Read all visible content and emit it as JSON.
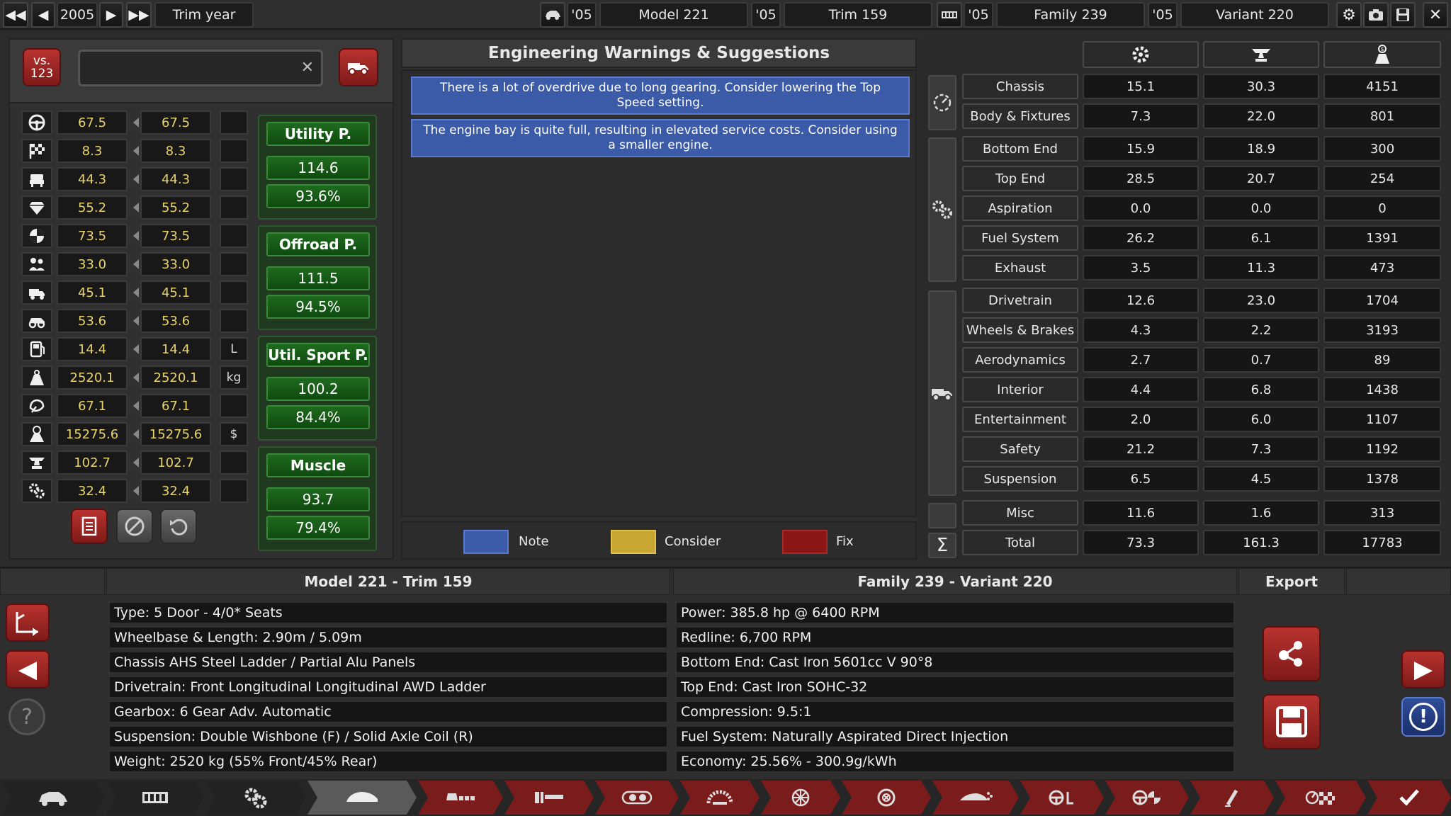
{
  "topbar": {
    "year": "2005",
    "trim_year_label": "Trim year",
    "model_year": "'05",
    "model_name": "Model 221",
    "trim_year": "'05",
    "trim_name": "Trim 159",
    "family_year": "'05",
    "family_name": "Family 239",
    "variant_year": "'05",
    "variant_name": "Variant 220"
  },
  "compare": {
    "vs_label": "vs.\n123",
    "search_value": "",
    "clear_glyph": "✕"
  },
  "stats": [
    {
      "icon": "steering-wheel-icon",
      "a": "67.5",
      "b": "67.5",
      "unit": ""
    },
    {
      "icon": "checkered-flag-icon",
      "a": "8.3",
      "b": "8.3",
      "unit": ""
    },
    {
      "icon": "seat-icon",
      "a": "44.3",
      "b": "44.3",
      "unit": ""
    },
    {
      "icon": "diamond-icon",
      "a": "55.2",
      "b": "55.2",
      "unit": ""
    },
    {
      "icon": "safety-icon",
      "a": "73.5",
      "b": "73.5",
      "unit": ""
    },
    {
      "icon": "passengers-icon",
      "a": "33.0",
      "b": "33.0",
      "unit": ""
    },
    {
      "icon": "cargo-icon",
      "a": "45.1",
      "b": "45.1",
      "unit": ""
    },
    {
      "icon": "offroad-icon",
      "a": "53.6",
      "b": "53.6",
      "unit": ""
    },
    {
      "icon": "fuel-icon",
      "a": "14.4",
      "b": "14.4",
      "unit": "L"
    },
    {
      "icon": "weight-icon",
      "a": "2520.1",
      "b": "2520.1",
      "unit": "kg"
    },
    {
      "icon": "environment-icon",
      "a": "67.1",
      "b": "67.1",
      "unit": ""
    },
    {
      "icon": "cost-icon",
      "a": "15275.6",
      "b": "15275.6",
      "unit": "$"
    },
    {
      "icon": "anvil-icon",
      "a": "102.7",
      "b": "102.7",
      "unit": ""
    },
    {
      "icon": "engineering-icon",
      "a": "32.4",
      "b": "32.4",
      "unit": ""
    }
  ],
  "scores": [
    {
      "label": "Utility P.",
      "value": "114.6",
      "percent": "93.6%"
    },
    {
      "label": "Offroad P.",
      "value": "111.5",
      "percent": "94.5%"
    },
    {
      "label": "Util. Sport P.",
      "value": "100.2",
      "percent": "84.4%"
    },
    {
      "label": "Muscle",
      "value": "93.7",
      "percent": "79.4%"
    }
  ],
  "warnings": {
    "title": "Engineering Warnings & Suggestions",
    "items": [
      "There is a lot of overdrive due to long gearing. Consider lowering the Top Speed setting.",
      "The engine bay is quite full, resulting in elevated service costs. Consider using a smaller engine."
    ],
    "legend": {
      "note": "Note",
      "consider": "Consider",
      "fix": "Fix"
    },
    "colors": {
      "note": "#3b5aa8",
      "consider": "#c8a832",
      "fix": "#8a1515"
    }
  },
  "breakdown": {
    "rows": [
      {
        "label": "Chassis",
        "eng": "15.1",
        "prod": "30.3",
        "cost": "4151"
      },
      {
        "label": "Body & Fixtures",
        "eng": "7.3",
        "prod": "22.0",
        "cost": "801"
      },
      {
        "label": "Bottom End",
        "eng": "15.9",
        "prod": "18.9",
        "cost": "300"
      },
      {
        "label": "Top End",
        "eng": "28.5",
        "prod": "20.7",
        "cost": "254"
      },
      {
        "label": "Aspiration",
        "eng": "0.0",
        "prod": "0.0",
        "cost": "0"
      },
      {
        "label": "Fuel System",
        "eng": "26.2",
        "prod": "6.1",
        "cost": "1391"
      },
      {
        "label": "Exhaust",
        "eng": "3.5",
        "prod": "11.3",
        "cost": "473"
      },
      {
        "label": "Drivetrain",
        "eng": "12.6",
        "prod": "23.0",
        "cost": "1704"
      },
      {
        "label": "Wheels & Brakes",
        "eng": "4.3",
        "prod": "2.2",
        "cost": "3193"
      },
      {
        "label": "Aerodynamics",
        "eng": "2.7",
        "prod": "0.7",
        "cost": "89"
      },
      {
        "label": "Interior",
        "eng": "4.4",
        "prod": "6.8",
        "cost": "1438"
      },
      {
        "label": "Entertainment",
        "eng": "2.0",
        "prod": "6.0",
        "cost": "1107"
      },
      {
        "label": "Safety",
        "eng": "21.2",
        "prod": "7.3",
        "cost": "1192"
      },
      {
        "label": "Suspension",
        "eng": "6.5",
        "prod": "4.5",
        "cost": "1378"
      },
      {
        "label": "Misc",
        "eng": "11.6",
        "prod": "1.6",
        "cost": "313"
      },
      {
        "label": "Total",
        "eng": "73.3",
        "prod": "161.3",
        "cost": "17783"
      }
    ],
    "sum_glyph": "Σ"
  },
  "bottom": {
    "left_title": "Model 221 - Trim 159",
    "right_title": "Family 239 - Variant 220",
    "export_title": "Export",
    "left_lines": [
      "Type: 5 Door - 4/0* Seats",
      "Wheelbase & Length: 2.90m / 5.09m",
      "Chassis AHS Steel Ladder / Partial Alu Panels",
      "Drivetrain: Front Longitudinal Longitudinal AWD Ladder",
      "Gearbox: 6 Gear Adv. Automatic",
      "Suspension: Double Wishbone (F) / Solid Axle Coil (R)",
      "Weight: 2520 kg (55% Front/45% Rear)"
    ],
    "right_lines": [
      "Power: 385.8 hp @ 6400 RPM",
      "Redline:  6,700 RPM",
      "Bottom End: Cast Iron 5601cc V 90°8",
      "Top End: Cast Iron SOHC-32",
      "Compression: 9.5:1",
      "Fuel System: Naturally Aspirated Direct Injection",
      "Economy: 25.56% - 300.9g/kWh"
    ],
    "help_glyph": "?",
    "info_glyph": "!"
  }
}
